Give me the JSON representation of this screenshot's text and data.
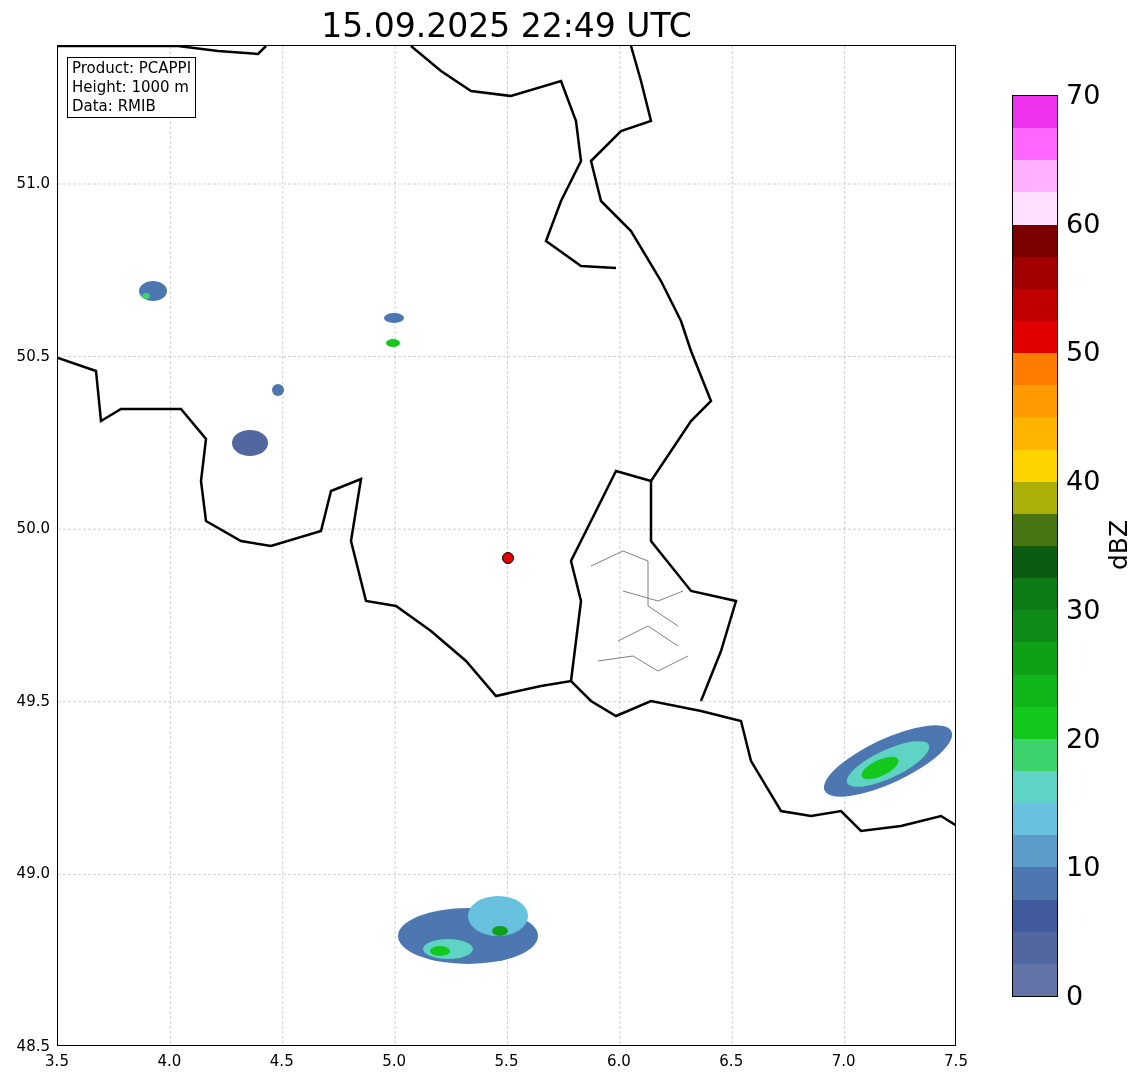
{
  "title": "15.09.2025 22:49 UTC",
  "info_box": [
    "Product: PCAPPI",
    "Height: 1000 m",
    "Data: RMIB"
  ],
  "x_ticks": [
    "3.5",
    "4.0",
    "4.5",
    "5.0",
    "5.5",
    "6.0",
    "6.5",
    "7.0",
    "7.5"
  ],
  "y_ticks": [
    "51.0",
    "50.5",
    "50.0",
    "49.5",
    "49.0",
    "48.5"
  ],
  "colorbar": {
    "label": "dBZ",
    "ticks": [
      "70",
      "60",
      "50",
      "40",
      "30",
      "20",
      "10",
      "0"
    ],
    "segments": [
      {
        "color": "#6373a8"
      },
      {
        "color": "#52669f"
      },
      {
        "color": "#415aa0"
      },
      {
        "color": "#4c77b0"
      },
      {
        "color": "#5b9dc8"
      },
      {
        "color": "#68c1de"
      },
      {
        "color": "#5fd3c4"
      },
      {
        "color": "#3dd36c"
      },
      {
        "color": "#12c81a"
      },
      {
        "color": "#10b51a"
      },
      {
        "color": "#10a016"
      },
      {
        "color": "#0e8b16"
      },
      {
        "color": "#0c7a15"
      },
      {
        "color": "#0a5c10"
      },
      {
        "color": "#467512"
      },
      {
        "color": "#aab008"
      },
      {
        "color": "#fdd300"
      },
      {
        "color": "#fdb300"
      },
      {
        "color": "#ff9a00"
      },
      {
        "color": "#ff7c00"
      },
      {
        "color": "#e00000"
      },
      {
        "color": "#c00000"
      },
      {
        "color": "#a00000"
      },
      {
        "color": "#7a0000"
      },
      {
        "color": "#ffe0ff"
      },
      {
        "color": "#ffb0ff"
      },
      {
        "color": "#ff66ff"
      },
      {
        "color": "#ee33ee"
      }
    ]
  }
}
